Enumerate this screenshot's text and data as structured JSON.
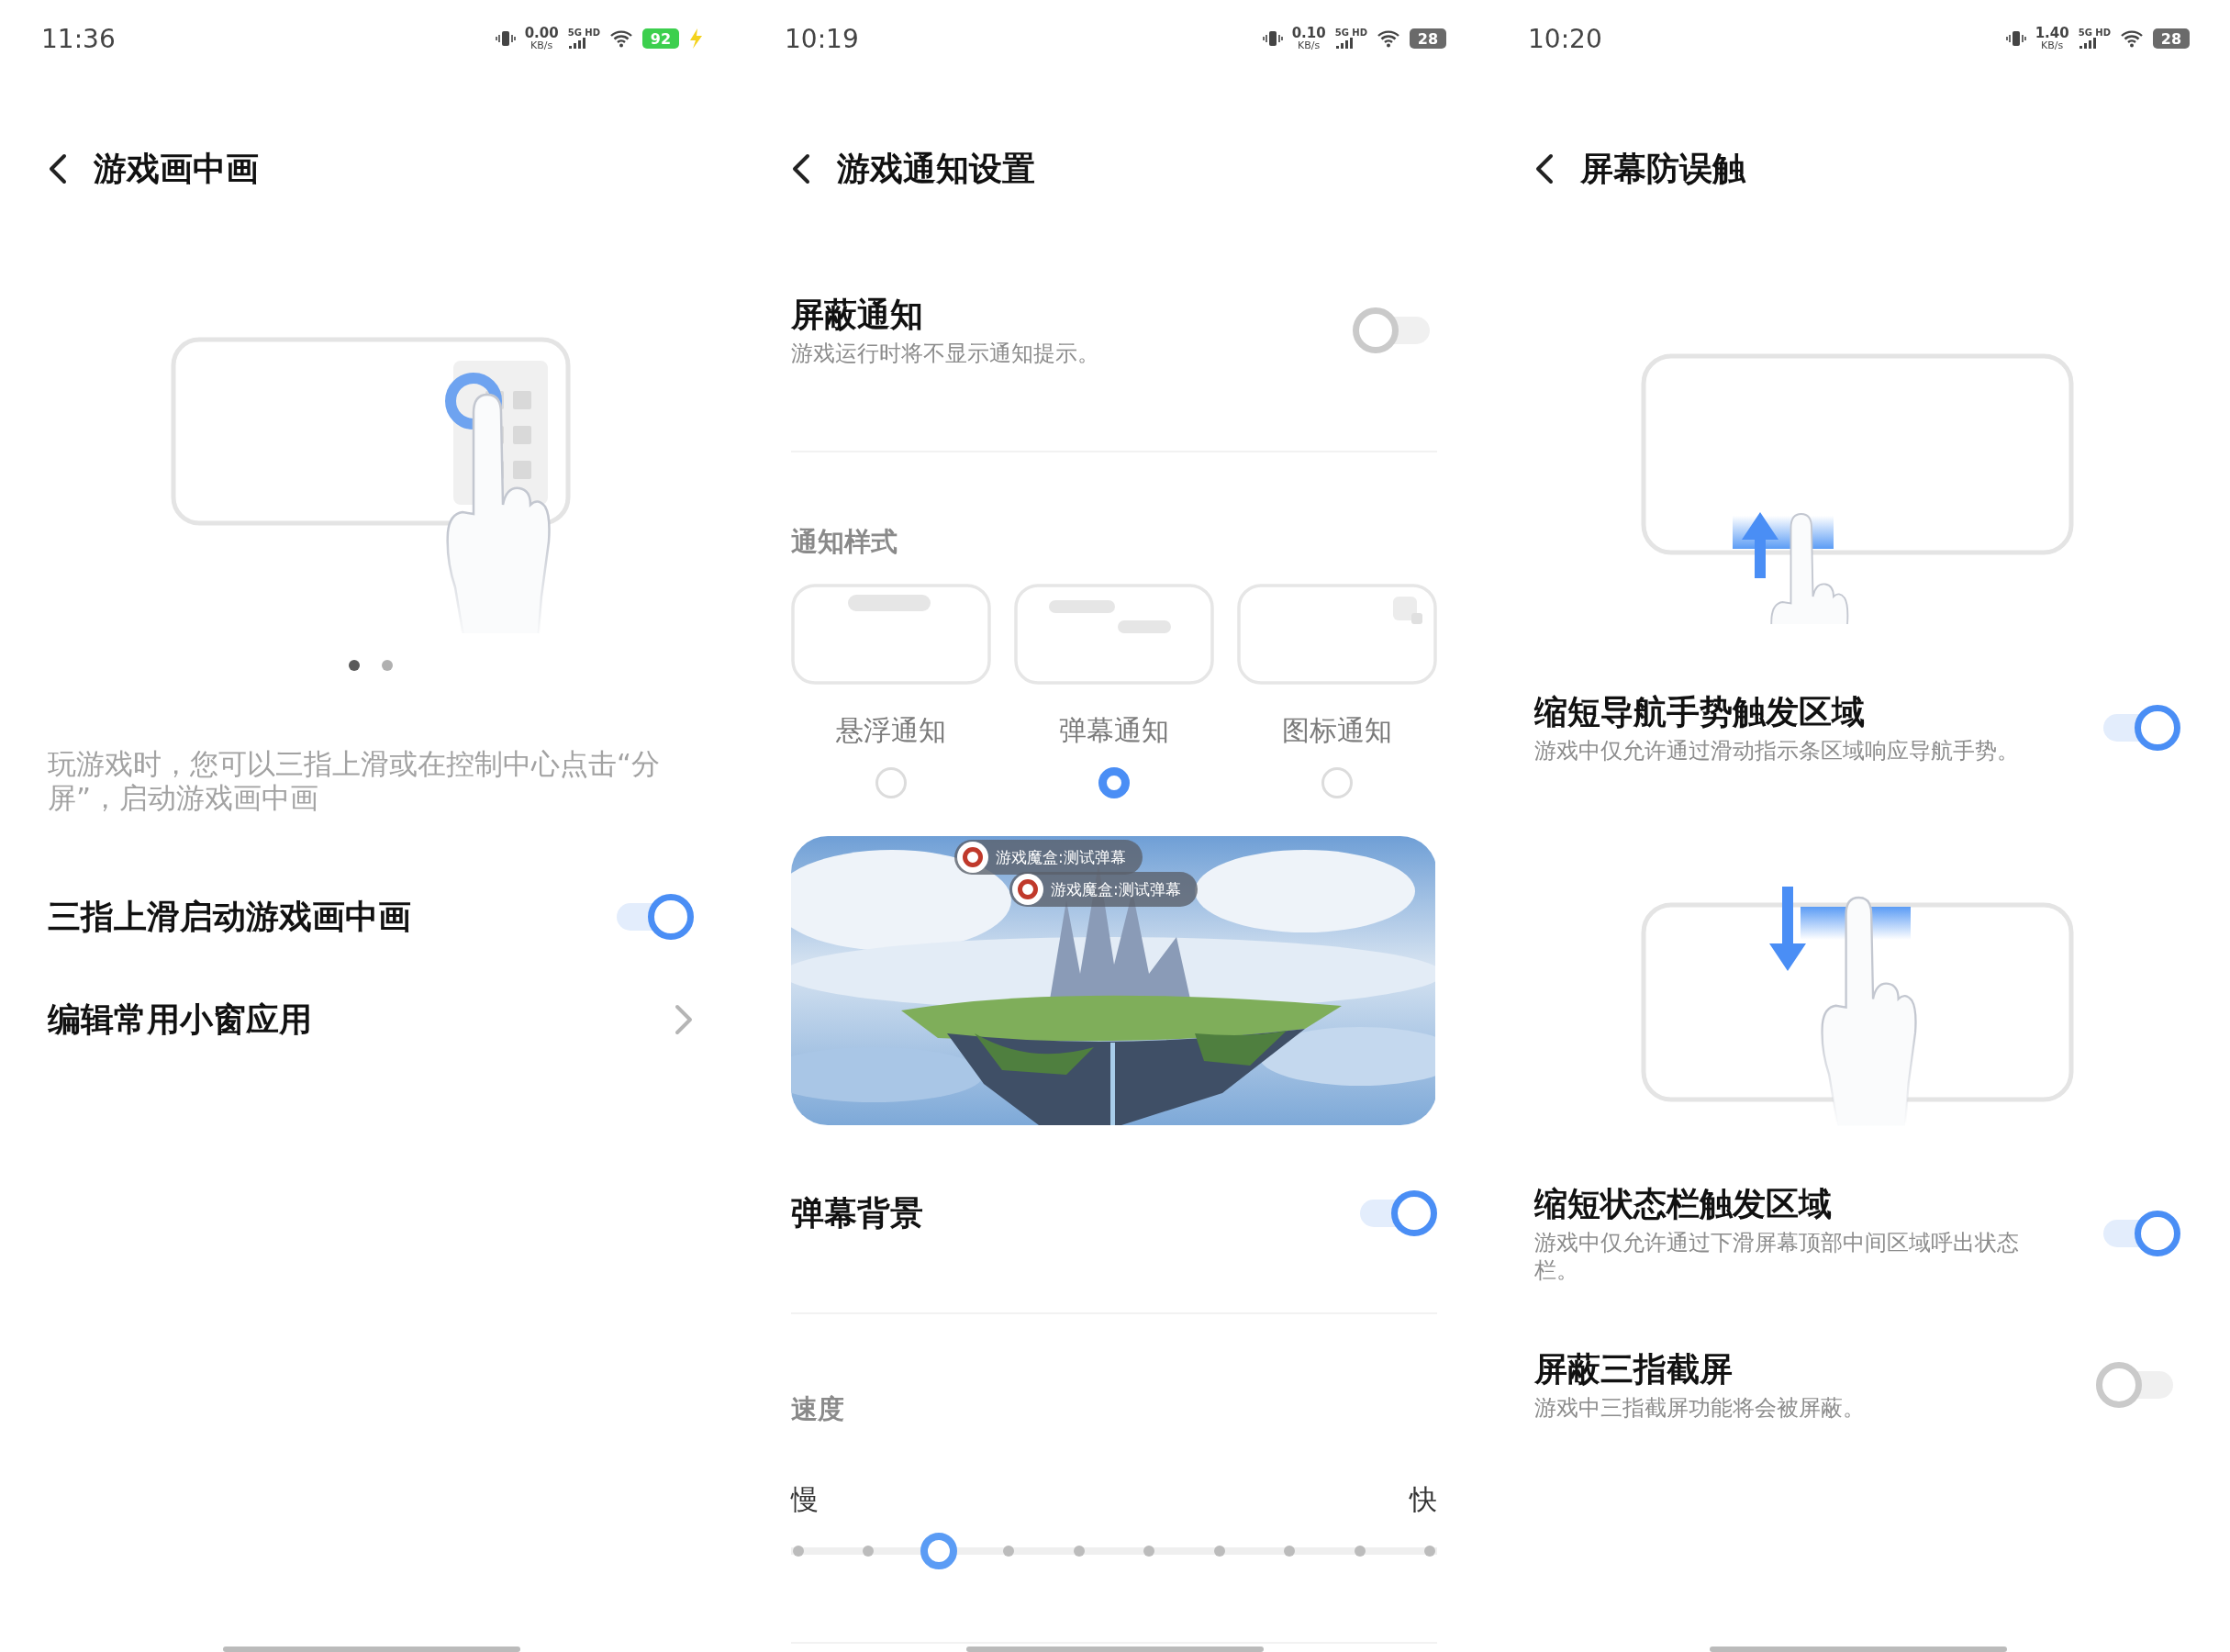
{
  "screens": [
    {
      "status_bar": {
        "time": "11:36",
        "speed": "0.00",
        "speed_unit": "KB/s",
        "network": "5G HD",
        "battery": "92",
        "charging": true
      },
      "title": "游戏画中画",
      "blocks": [
        {
          "kind": "tap_illustration"
        },
        {
          "kind": "pager",
          "pages": [
            {
              "selected": true
            },
            {
              "selected": false
            }
          ]
        },
        {
          "kind": "paragraph",
          "text": "玩游戏时，您可以三指上滑或在控制中心点击“分屏”，启动游戏画中画"
        },
        {
          "kind": "toggle",
          "title": "三指上滑启动游戏画中画",
          "on": true
        },
        {
          "kind": "link",
          "title": "编辑常用小窗应用"
        }
      ]
    },
    {
      "status_bar": {
        "time": "10:19",
        "speed": "0.10",
        "speed_unit": "KB/s",
        "network": "5G HD",
        "battery": "28",
        "charging": false
      },
      "title": "游戏通知设置",
      "blocks": [
        {
          "kind": "toggle",
          "title": "屏蔽通知",
          "subtitle": "游戏运行时将不显示通知提示。",
          "on": false
        },
        {
          "kind": "divider"
        },
        {
          "kind": "section",
          "text": "通知样式"
        },
        {
          "kind": "options",
          "items": [
            {
              "label": "悬浮通知",
              "kind": "floating",
              "selected": false
            },
            {
              "label": "弹幕通知",
              "kind": "barrage",
              "selected": true
            },
            {
              "label": "图标通知",
              "kind": "icon",
              "selected": false
            }
          ]
        },
        {
          "kind": "preview",
          "danmaku": [
            {
              "text": "游戏魔盒:测试弹幕"
            },
            {
              "text": "游戏魔盒:测试弹幕"
            }
          ]
        },
        {
          "kind": "toggle",
          "title": "弹幕背景",
          "on": true
        },
        {
          "kind": "divider"
        },
        {
          "kind": "section",
          "text": "速度"
        },
        {
          "kind": "slider",
          "min_label": "慢",
          "max_label": "快",
          "level": 0.222
        },
        {
          "kind": "divider"
        }
      ]
    },
    {
      "status_bar": {
        "time": "10:20",
        "speed": "1.40",
        "speed_unit": "KB/s",
        "network": "5G HD",
        "battery": "28",
        "charging": false
      },
      "title": "屏幕防误触",
      "blocks": [
        {
          "kind": "swipe_up_illustration"
        },
        {
          "kind": "toggle",
          "title": "缩短导航手势触发区域",
          "subtitle": "游戏中仅允许通过滑动指示条区域响应导航手势。",
          "on": true
        },
        {
          "kind": "swipe_down_illustration"
        },
        {
          "kind": "toggle",
          "title": "缩短状态栏触发区域",
          "subtitle": "游戏中仅允许通过下滑屏幕顶部中间区域呼出状态栏。",
          "on": true
        },
        {
          "kind": "toggle",
          "title": "屏蔽三指截屏",
          "subtitle": "游戏中三指截屏功能将会被屏蔽。",
          "on": false
        }
      ]
    }
  ]
}
